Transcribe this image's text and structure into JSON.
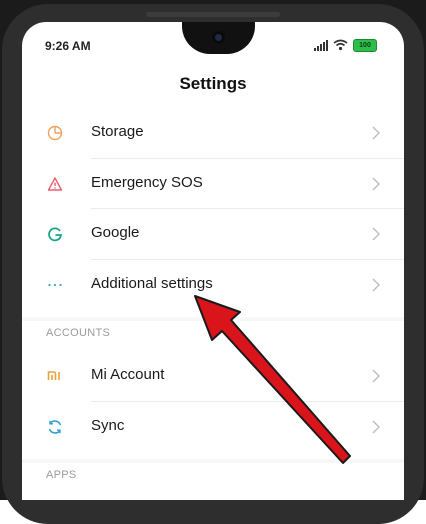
{
  "status_bar": {
    "time": "9:26 AM",
    "battery_label": "100",
    "icons": [
      "signal-icon",
      "wifi-icon",
      "battery-icon"
    ]
  },
  "header": {
    "title": "Settings"
  },
  "settings_items": [
    {
      "label": "Storage",
      "icon": "storage-icon",
      "icon_color": "#f0a35a"
    },
    {
      "label": "Emergency SOS",
      "icon": "emergency-sos-icon",
      "icon_color": "#e8616e"
    },
    {
      "label": "Google",
      "icon": "google-icon",
      "icon_color": "#1aa38a"
    },
    {
      "label": "Additional settings",
      "icon": "more-dots-icon",
      "icon_color": "#3fa8c9"
    }
  ],
  "accounts_section": {
    "header": "ACCOUNTS",
    "items": [
      {
        "label": "Mi Account",
        "icon": "mi-account-icon",
        "icon_color": "#e9a23b"
      },
      {
        "label": "Sync",
        "icon": "sync-icon",
        "icon_color": "#2a9fc7"
      }
    ]
  },
  "apps_section": {
    "header": "APPS"
  },
  "annotation": {
    "arrow_color": "#d9141b",
    "target": "Additional settings"
  }
}
